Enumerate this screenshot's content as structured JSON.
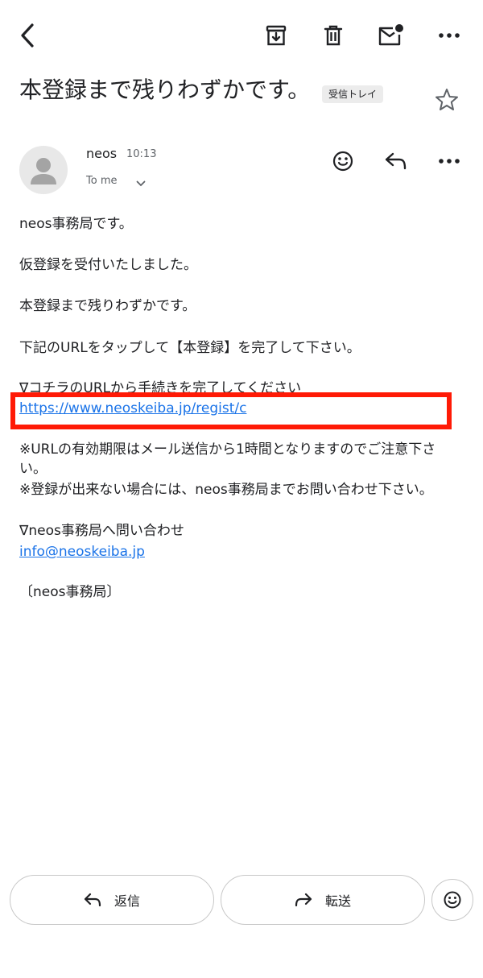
{
  "toolbar": {
    "back_icon": "chevron-left-icon",
    "archive_icon": "archive-icon",
    "delete_icon": "trash-icon",
    "mark_unread_icon": "mail-unread-icon",
    "more_icon": "more-horizontal-icon"
  },
  "subject": {
    "title": "本登録まで残りわずかです。",
    "label": "受信トレイ",
    "star_icon": "star-outline-icon"
  },
  "message": {
    "sender": "neos",
    "time": "10:13",
    "recipient": "To me",
    "body": {
      "line1": "neos事務局です。",
      "line2": "仮登録を受付いたしました。",
      "line3": "本登録まで残りわずかです。",
      "line4": "下記のURLをタップして【本登録】を完了して下さい。",
      "line5": "∇コチラのURLから手続きを完了してください",
      "link": "https://www.neoskeiba.jp/regist/c",
      "note1a": "※URLの有効期限はメール送信から1時間となりますのでご注意下さ",
      "note1b": "い。",
      "note2": "※登録が出来ない場合には、neos事務局までお問い合わせ下さい。",
      "contact_heading": "∇neos事務局へ問い合わせ",
      "contact_email": "info@neoskeiba.jp",
      "signature": "〔neos事務局〕"
    }
  },
  "actions": {
    "reply_label": "返信",
    "forward_label": "転送"
  },
  "colors": {
    "link": "#1a73e8",
    "highlight": "#ff1a06"
  }
}
